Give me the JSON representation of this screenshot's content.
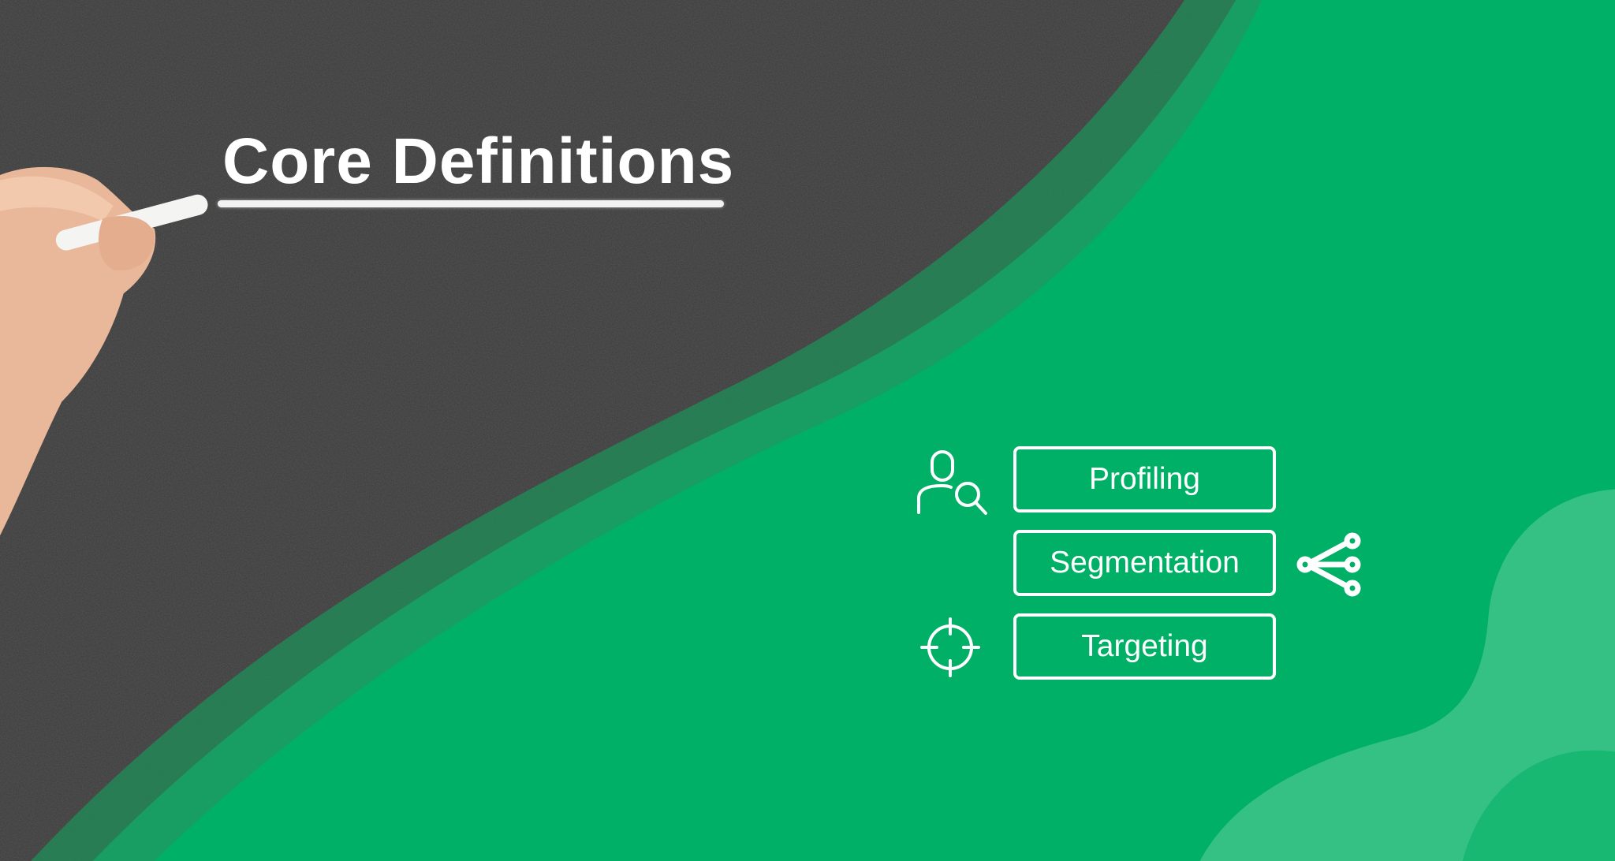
{
  "slide": {
    "title": "Core Definitions",
    "items": [
      {
        "label": "Profiling",
        "icon": "user-search-icon"
      },
      {
        "label": "Segmentation",
        "icon": "share-nodes-icon"
      },
      {
        "label": "Targeting",
        "icon": "crosshair-icon"
      }
    ]
  },
  "colors": {
    "chalkboard": "#3b3b3b",
    "green": "#00b066",
    "light_green": "#35c184"
  }
}
